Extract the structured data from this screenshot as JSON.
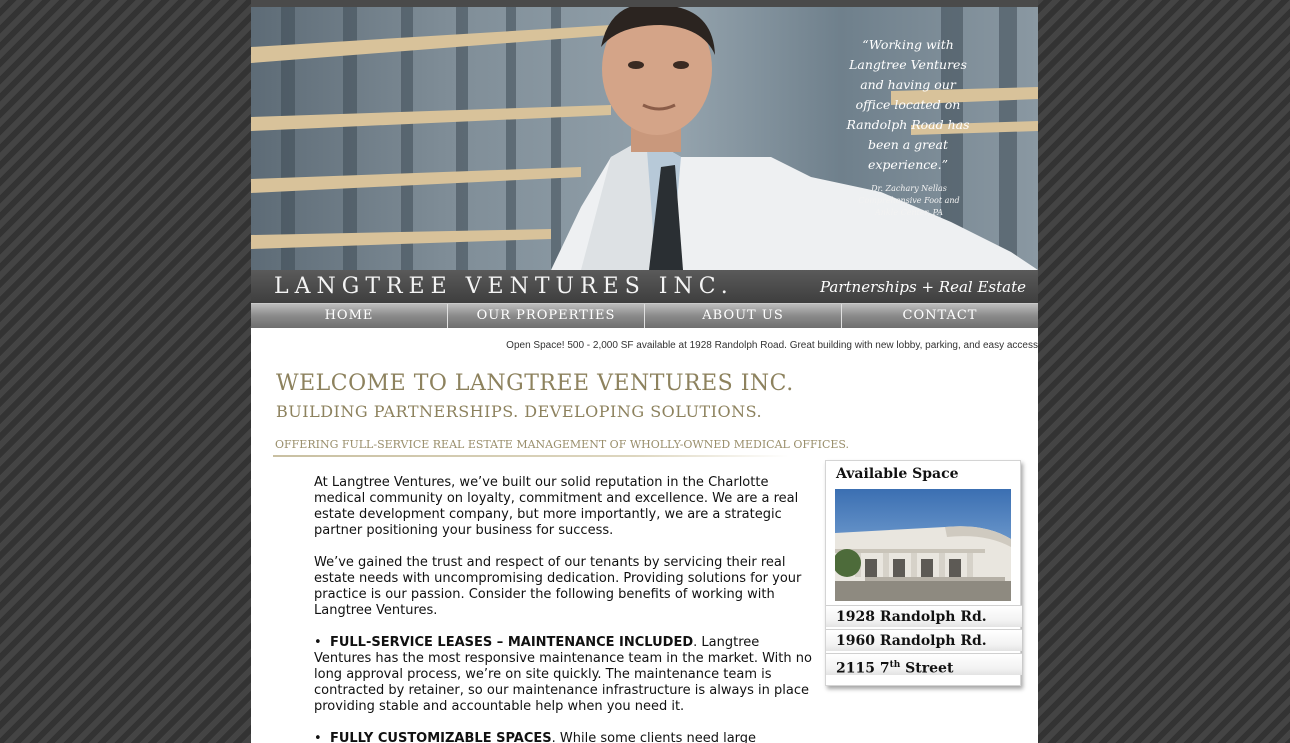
{
  "hero": {
    "quote": "“Working with Langtree Ventures and having our office located on Randolph Road has been a great experience.”",
    "cite": "Dr. Zachary Nellas Comprehensive Foot and Ankle Center, PA"
  },
  "brand": {
    "name": "LANGTREE VENTURES INC.",
    "tagline": "Partnerships + Real Estate"
  },
  "nav": {
    "home": "HOME",
    "properties": "OUR PROPERTIES",
    "about": "ABOUT US",
    "contact": "CONTACT"
  },
  "ticker": "Open Space! 500 - 2,000 SF available at 1928 Randolph Road.  Great building with new lobby, parking, and easy access",
  "headings": {
    "welcome": "WELCOME TO LANGTREE VENTURES INC.",
    "subhead": "BUILDING PARTNERSHIPS.  DEVELOPING SOLUTIONS.",
    "offering": "OFFERING FULL-SERVICE REAL ESTATE MANAGEMENT OF WHOLLY-OWNED MEDICAL OFFICES."
  },
  "content": {
    "p1": "At Langtree Ventures, we’ve built our solid reputation in the Charlotte medical community on loyalty, commitment and excellence. We are a real estate development company, but more importantly, we are a strategic partner positioning your business for success.",
    "p2": "We’ve gained the trust and respect of our tenants by servicing their real estate needs with uncompromising dedication. Providing solutions for your practice is our passion. Consider the following benefits of working with Langtree Ventures.",
    "b1_title": "FULL-SERVICE LEASES – MAINTENANCE INCLUDED",
    "b1_text": ". Langtree Ventures has the most responsive maintenance team in the market. With no long approval process, we’re on site quickly. The maintenance team is contracted by retainer, so our maintenance infrastructure is always in place providing stable and accountable help when you need it.",
    "b2_title": "FULLY CUSTOMIZABLE SPACES",
    "b2_text": ". While some clients need large"
  },
  "sidebar": {
    "title": "Available Space",
    "links": {
      "l1": "1928 Randolph Rd.",
      "l2": "1960 Randolph Rd.",
      "l3_num": "2115 7",
      "l3_sup": "th",
      "l3_rest": " Street"
    }
  }
}
